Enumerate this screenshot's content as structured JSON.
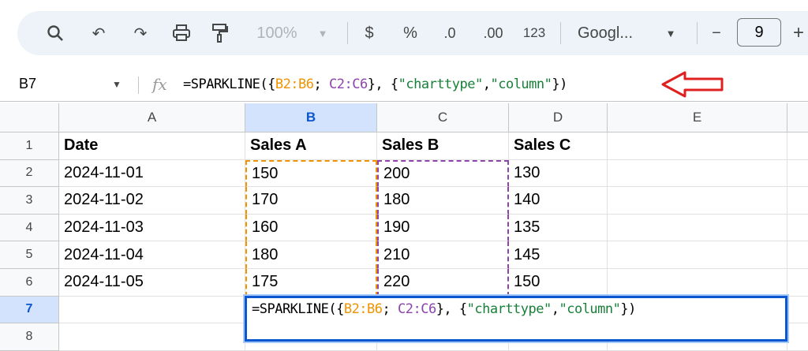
{
  "toolbar": {
    "zoom": "100%",
    "currency": "$",
    "percent": "%",
    "dec_decrease": ".0",
    "dec_increase": ".00",
    "format_123": "123",
    "font": "Googl...",
    "font_size": "9",
    "minus": "−",
    "plus": "+"
  },
  "formula_bar": {
    "cell_ref": "B7",
    "fx": "fx",
    "parts": [
      "=SPARKLINE({",
      "B2:B6",
      "; ",
      "C2:C6",
      "}, {",
      "\"charttype\"",
      ",",
      "\"column\"",
      "})"
    ]
  },
  "columns": [
    "A",
    "B",
    "C",
    "D",
    "E"
  ],
  "rows": [
    "1",
    "2",
    "3",
    "4",
    "5",
    "6",
    "7",
    "8"
  ],
  "cells": [
    [
      "Date",
      "Sales A",
      "Sales B",
      "Sales C"
    ],
    [
      "2024-11-01",
      "150",
      "200",
      "130"
    ],
    [
      "2024-11-02",
      "170",
      "180",
      "140"
    ],
    [
      "2024-11-03",
      "160",
      "190",
      "135"
    ],
    [
      "2024-11-04",
      "180",
      "210",
      "145"
    ],
    [
      "2024-11-05",
      "175",
      "220",
      "150"
    ]
  ],
  "colors": {
    "range_b": "#f09300",
    "range_c": "#8e44ad",
    "string": "#188038",
    "active": "#0b57d0",
    "arrow": "#e02020"
  }
}
